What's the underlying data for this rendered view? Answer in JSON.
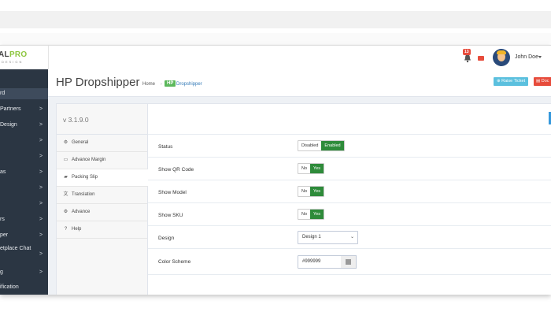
{
  "header": {
    "logo_main": "AL",
    "logo_pro": "PRO",
    "logo_sub": "DESIGN",
    "notification_count": "13",
    "user_name": "John Doe"
  },
  "sidebar": {
    "items": [
      {
        "label": "rd",
        "arrow": ""
      },
      {
        "label": "Partners",
        "arrow": ">"
      },
      {
        "label": "Design",
        "arrow": ">"
      },
      {
        "label": "",
        "arrow": ">"
      },
      {
        "label": "",
        "arrow": ">"
      },
      {
        "label": "as",
        "arrow": ">"
      },
      {
        "label": "",
        "arrow": ">"
      },
      {
        "label": "",
        "arrow": ">"
      },
      {
        "label": "rs",
        "arrow": ">"
      },
      {
        "label": "per",
        "arrow": ">"
      },
      {
        "label": "etplace Chat",
        "arrow": ">"
      },
      {
        "label": "g",
        "arrow": ">"
      },
      {
        "label": "ification",
        "arrow": ""
      }
    ]
  },
  "page": {
    "title": "HP Dropshipper",
    "breadcrumb_home": "Home",
    "breadcrumb_sep": "›",
    "breadcrumb_badge": "HP",
    "breadcrumb_current": "Dropshipper",
    "raise_ticket": "Raise Ticket",
    "doc_button": "Doc"
  },
  "tabs": {
    "version": "v 3.1.9.0",
    "items": [
      {
        "label": "General",
        "icon": "gear-icon",
        "glyph": "⚙"
      },
      {
        "label": "Advance Margin",
        "icon": "credit-card-icon",
        "glyph": "▭"
      },
      {
        "label": "Packing Slip",
        "icon": "truck-icon",
        "glyph": "▰"
      },
      {
        "label": "Translation",
        "icon": "language-icon",
        "glyph": "文"
      },
      {
        "label": "Advance",
        "icon": "gears-icon",
        "glyph": "⚙"
      },
      {
        "label": "Help",
        "icon": "question-icon",
        "glyph": "?"
      }
    ],
    "active_index": 2
  },
  "form": {
    "status": {
      "label": "Status",
      "off": "Disabled",
      "on": "Enabled"
    },
    "show_qr": {
      "label": "Show QR Code",
      "off": "No",
      "on": "Yes"
    },
    "show_model": {
      "label": "Show Model",
      "off": "No",
      "on": "Yes"
    },
    "show_sku": {
      "label": "Show SKU",
      "off": "No",
      "on": "Yes"
    },
    "design": {
      "label": "Design",
      "value": "Design 1"
    },
    "color_scheme": {
      "label": "Color Scheme",
      "value": "#999999"
    }
  },
  "colors": {
    "sidebar": "#2b3643",
    "toggle_on": "#2e8b3a",
    "raise_ticket": "#5bc0de",
    "doc": "#e74c3c",
    "swatch": "#999999"
  }
}
